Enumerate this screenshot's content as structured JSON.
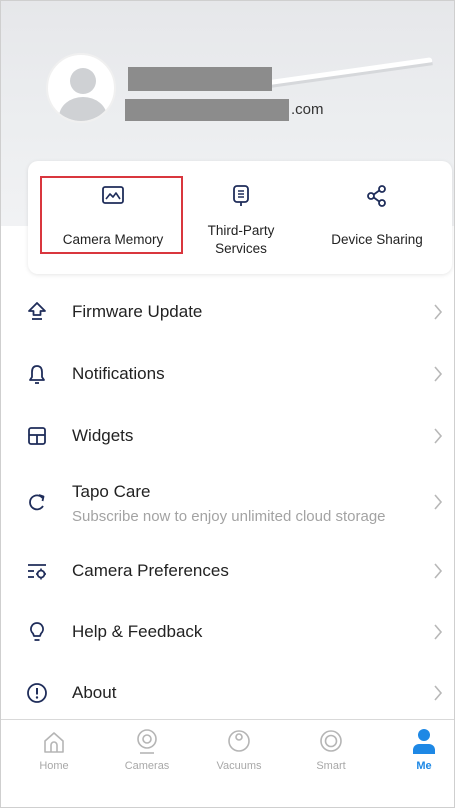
{
  "profile": {
    "email_suffix": ".com"
  },
  "quick_actions": [
    {
      "label": "Camera Memory",
      "icon": "camera-memory-icon"
    },
    {
      "label_line1": "Third-Party",
      "label_line2": "Services",
      "icon": "third-party-services-icon"
    },
    {
      "label": "Device Sharing",
      "icon": "share-icon"
    }
  ],
  "menu": {
    "firmware": "Firmware Update",
    "notifications": "Notifications",
    "widgets": "Widgets",
    "tapo_care": "Tapo Care",
    "tapo_care_sub": "Subscribe now to enjoy unlimited cloud storage",
    "camera_prefs": "Camera Preferences",
    "help": "Help & Feedback",
    "about": "About"
  },
  "tabs": [
    {
      "label": "Home",
      "icon": "home-icon"
    },
    {
      "label": "Cameras",
      "icon": "camera-icon"
    },
    {
      "label": "Vacuums",
      "icon": "vacuum-icon"
    },
    {
      "label": "Smart",
      "icon": "smart-icon"
    },
    {
      "label": "Me",
      "icon": "person-icon",
      "active": true
    }
  ],
  "colors": {
    "accent": "#1e88e5",
    "highlight_border": "#d9363e",
    "icon": "#1f2d5a"
  }
}
